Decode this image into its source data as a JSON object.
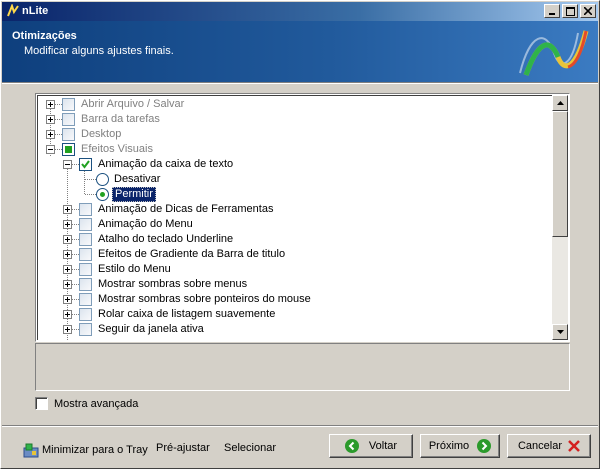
{
  "window": {
    "title": "nLite"
  },
  "header": {
    "title": "Otimizações",
    "subtitle": "Modificar alguns ajustes finais."
  },
  "tree": {
    "items": [
      {
        "label": "Abrir Arquivo / Salvar",
        "level": 0,
        "expander": "plus",
        "check": "plain",
        "grey": true
      },
      {
        "label": "Barra da tarefas",
        "level": 0,
        "expander": "plus",
        "check": "plain",
        "grey": true
      },
      {
        "label": "Desktop",
        "level": 0,
        "expander": "plus",
        "check": "plain",
        "grey": true
      },
      {
        "label": "Efeitos Visuais",
        "level": 0,
        "expander": "minus",
        "check": "green",
        "grey": true
      },
      {
        "label": "Animação da caixa de texto",
        "level": 1,
        "expander": "minus",
        "check": "checked",
        "grey": false
      },
      {
        "label": "Desativar",
        "level": 2,
        "expander": "none",
        "check": "radio",
        "grey": false
      },
      {
        "label": "Permitir",
        "level": 2,
        "expander": "none",
        "check": "radio-on",
        "grey": false,
        "selected": true
      },
      {
        "label": "Animação de Dicas de Ferramentas",
        "level": 1,
        "expander": "plus",
        "check": "plain",
        "grey": false
      },
      {
        "label": "Animação do Menu",
        "level": 1,
        "expander": "plus",
        "check": "plain",
        "grey": false
      },
      {
        "label": "Atalho do teclado Underline",
        "level": 1,
        "expander": "plus",
        "check": "plain",
        "grey": false
      },
      {
        "label": "Efeitos de Gradiente da Barra de titulo",
        "level": 1,
        "expander": "plus",
        "check": "plain",
        "grey": false
      },
      {
        "label": "Estilo do Menu",
        "level": 1,
        "expander": "plus",
        "check": "plain",
        "grey": false
      },
      {
        "label": "Mostrar sombras sobre menus",
        "level": 1,
        "expander": "plus",
        "check": "plain",
        "grey": false
      },
      {
        "label": "Mostrar sombras sobre ponteiros do mouse",
        "level": 1,
        "expander": "plus",
        "check": "plain",
        "grey": false
      },
      {
        "label": "Rolar caixa de listagem suavemente",
        "level": 1,
        "expander": "plus",
        "check": "plain",
        "grey": false
      },
      {
        "label": "Seguir da janela ativa",
        "level": 1,
        "expander": "plus",
        "check": "plain",
        "grey": false
      }
    ]
  },
  "options": {
    "advanced_label": "Mostra avançada"
  },
  "footer": {
    "tray_label": "Minimizar para o Tray",
    "preset_label": "Pré-ajustar",
    "select_label": "Selecionar",
    "back_label": "Voltar",
    "next_label": "Próximo",
    "cancel_label": "Cancelar"
  },
  "colors": {
    "header_bg": "#215a9c",
    "title_bar": "#0a246a",
    "accent_green": "#2b9a2b",
    "cancel_red": "#d42020"
  }
}
